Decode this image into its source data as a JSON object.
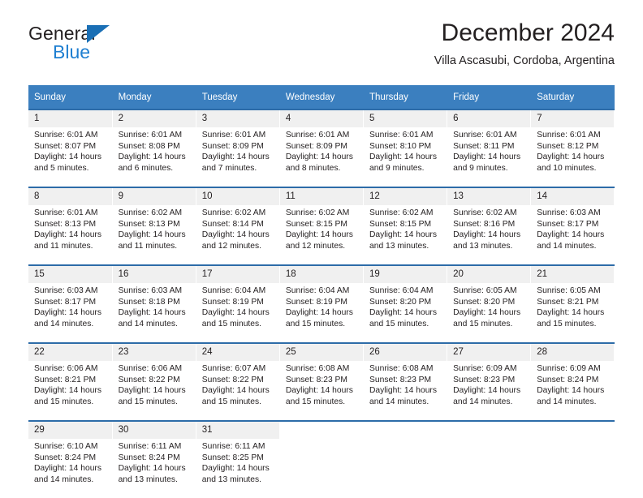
{
  "brand": {
    "name_top": "General",
    "name_bottom": "Blue",
    "triangle_color": "#1a6fb5",
    "blue_text_color": "#1f7fd1"
  },
  "header": {
    "title": "December 2024",
    "subtitle": "Villa Ascasubi, Cordoba, Argentina"
  },
  "theme": {
    "header_bg": "#3b7fbf",
    "week_separator": "#2d6ca8",
    "daynum_bg": "#f0f0f0",
    "text": "#231f20"
  },
  "calendar": {
    "weekday_headers": [
      "Sunday",
      "Monday",
      "Tuesday",
      "Wednesday",
      "Thursday",
      "Friday",
      "Saturday"
    ],
    "weeks": [
      [
        {
          "day": "1",
          "sunrise": "Sunrise: 6:01 AM",
          "sunset": "Sunset: 8:07 PM",
          "daylight1": "Daylight: 14 hours",
          "daylight2": "and 5 minutes."
        },
        {
          "day": "2",
          "sunrise": "Sunrise: 6:01 AM",
          "sunset": "Sunset: 8:08 PM",
          "daylight1": "Daylight: 14 hours",
          "daylight2": "and 6 minutes."
        },
        {
          "day": "3",
          "sunrise": "Sunrise: 6:01 AM",
          "sunset": "Sunset: 8:09 PM",
          "daylight1": "Daylight: 14 hours",
          "daylight2": "and 7 minutes."
        },
        {
          "day": "4",
          "sunrise": "Sunrise: 6:01 AM",
          "sunset": "Sunset: 8:09 PM",
          "daylight1": "Daylight: 14 hours",
          "daylight2": "and 8 minutes."
        },
        {
          "day": "5",
          "sunrise": "Sunrise: 6:01 AM",
          "sunset": "Sunset: 8:10 PM",
          "daylight1": "Daylight: 14 hours",
          "daylight2": "and 9 minutes."
        },
        {
          "day": "6",
          "sunrise": "Sunrise: 6:01 AM",
          "sunset": "Sunset: 8:11 PM",
          "daylight1": "Daylight: 14 hours",
          "daylight2": "and 9 minutes."
        },
        {
          "day": "7",
          "sunrise": "Sunrise: 6:01 AM",
          "sunset": "Sunset: 8:12 PM",
          "daylight1": "Daylight: 14 hours",
          "daylight2": "and 10 minutes."
        }
      ],
      [
        {
          "day": "8",
          "sunrise": "Sunrise: 6:01 AM",
          "sunset": "Sunset: 8:13 PM",
          "daylight1": "Daylight: 14 hours",
          "daylight2": "and 11 minutes."
        },
        {
          "day": "9",
          "sunrise": "Sunrise: 6:02 AM",
          "sunset": "Sunset: 8:13 PM",
          "daylight1": "Daylight: 14 hours",
          "daylight2": "and 11 minutes."
        },
        {
          "day": "10",
          "sunrise": "Sunrise: 6:02 AM",
          "sunset": "Sunset: 8:14 PM",
          "daylight1": "Daylight: 14 hours",
          "daylight2": "and 12 minutes."
        },
        {
          "day": "11",
          "sunrise": "Sunrise: 6:02 AM",
          "sunset": "Sunset: 8:15 PM",
          "daylight1": "Daylight: 14 hours",
          "daylight2": "and 12 minutes."
        },
        {
          "day": "12",
          "sunrise": "Sunrise: 6:02 AM",
          "sunset": "Sunset: 8:15 PM",
          "daylight1": "Daylight: 14 hours",
          "daylight2": "and 13 minutes."
        },
        {
          "day": "13",
          "sunrise": "Sunrise: 6:02 AM",
          "sunset": "Sunset: 8:16 PM",
          "daylight1": "Daylight: 14 hours",
          "daylight2": "and 13 minutes."
        },
        {
          "day": "14",
          "sunrise": "Sunrise: 6:03 AM",
          "sunset": "Sunset: 8:17 PM",
          "daylight1": "Daylight: 14 hours",
          "daylight2": "and 14 minutes."
        }
      ],
      [
        {
          "day": "15",
          "sunrise": "Sunrise: 6:03 AM",
          "sunset": "Sunset: 8:17 PM",
          "daylight1": "Daylight: 14 hours",
          "daylight2": "and 14 minutes."
        },
        {
          "day": "16",
          "sunrise": "Sunrise: 6:03 AM",
          "sunset": "Sunset: 8:18 PM",
          "daylight1": "Daylight: 14 hours",
          "daylight2": "and 14 minutes."
        },
        {
          "day": "17",
          "sunrise": "Sunrise: 6:04 AM",
          "sunset": "Sunset: 8:19 PM",
          "daylight1": "Daylight: 14 hours",
          "daylight2": "and 15 minutes."
        },
        {
          "day": "18",
          "sunrise": "Sunrise: 6:04 AM",
          "sunset": "Sunset: 8:19 PM",
          "daylight1": "Daylight: 14 hours",
          "daylight2": "and 15 minutes."
        },
        {
          "day": "19",
          "sunrise": "Sunrise: 6:04 AM",
          "sunset": "Sunset: 8:20 PM",
          "daylight1": "Daylight: 14 hours",
          "daylight2": "and 15 minutes."
        },
        {
          "day": "20",
          "sunrise": "Sunrise: 6:05 AM",
          "sunset": "Sunset: 8:20 PM",
          "daylight1": "Daylight: 14 hours",
          "daylight2": "and 15 minutes."
        },
        {
          "day": "21",
          "sunrise": "Sunrise: 6:05 AM",
          "sunset": "Sunset: 8:21 PM",
          "daylight1": "Daylight: 14 hours",
          "daylight2": "and 15 minutes."
        }
      ],
      [
        {
          "day": "22",
          "sunrise": "Sunrise: 6:06 AM",
          "sunset": "Sunset: 8:21 PM",
          "daylight1": "Daylight: 14 hours",
          "daylight2": "and 15 minutes."
        },
        {
          "day": "23",
          "sunrise": "Sunrise: 6:06 AM",
          "sunset": "Sunset: 8:22 PM",
          "daylight1": "Daylight: 14 hours",
          "daylight2": "and 15 minutes."
        },
        {
          "day": "24",
          "sunrise": "Sunrise: 6:07 AM",
          "sunset": "Sunset: 8:22 PM",
          "daylight1": "Daylight: 14 hours",
          "daylight2": "and 15 minutes."
        },
        {
          "day": "25",
          "sunrise": "Sunrise: 6:08 AM",
          "sunset": "Sunset: 8:23 PM",
          "daylight1": "Daylight: 14 hours",
          "daylight2": "and 15 minutes."
        },
        {
          "day": "26",
          "sunrise": "Sunrise: 6:08 AM",
          "sunset": "Sunset: 8:23 PM",
          "daylight1": "Daylight: 14 hours",
          "daylight2": "and 14 minutes."
        },
        {
          "day": "27",
          "sunrise": "Sunrise: 6:09 AM",
          "sunset": "Sunset: 8:23 PM",
          "daylight1": "Daylight: 14 hours",
          "daylight2": "and 14 minutes."
        },
        {
          "day": "28",
          "sunrise": "Sunrise: 6:09 AM",
          "sunset": "Sunset: 8:24 PM",
          "daylight1": "Daylight: 14 hours",
          "daylight2": "and 14 minutes."
        }
      ],
      [
        {
          "day": "29",
          "sunrise": "Sunrise: 6:10 AM",
          "sunset": "Sunset: 8:24 PM",
          "daylight1": "Daylight: 14 hours",
          "daylight2": "and 14 minutes."
        },
        {
          "day": "30",
          "sunrise": "Sunrise: 6:11 AM",
          "sunset": "Sunset: 8:24 PM",
          "daylight1": "Daylight: 14 hours",
          "daylight2": "and 13 minutes."
        },
        {
          "day": "31",
          "sunrise": "Sunrise: 6:11 AM",
          "sunset": "Sunset: 8:25 PM",
          "daylight1": "Daylight: 14 hours",
          "daylight2": "and 13 minutes."
        },
        {
          "day": "",
          "sunrise": "",
          "sunset": "",
          "daylight1": "",
          "daylight2": ""
        },
        {
          "day": "",
          "sunrise": "",
          "sunset": "",
          "daylight1": "",
          "daylight2": ""
        },
        {
          "day": "",
          "sunrise": "",
          "sunset": "",
          "daylight1": "",
          "daylight2": ""
        },
        {
          "day": "",
          "sunrise": "",
          "sunset": "",
          "daylight1": "",
          "daylight2": ""
        }
      ]
    ]
  }
}
